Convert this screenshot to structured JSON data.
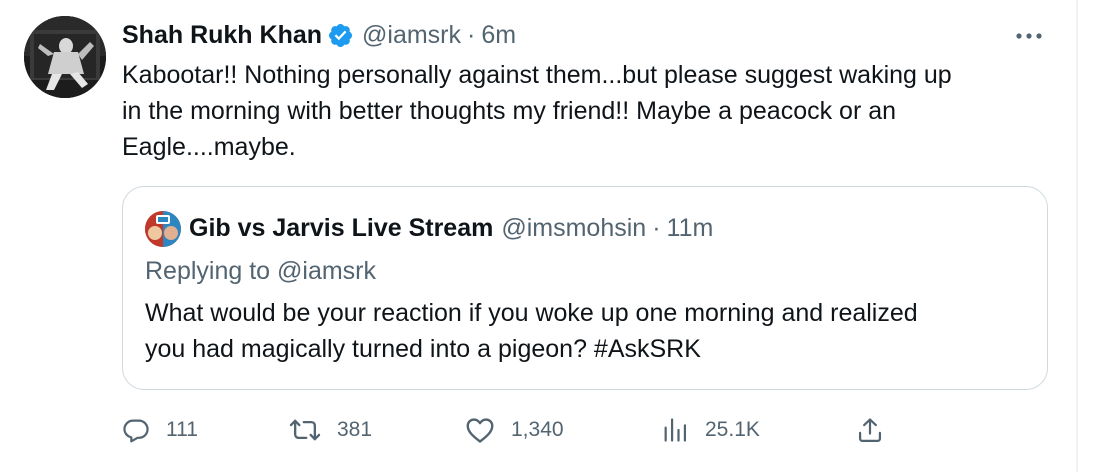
{
  "tweet": {
    "display_name": "Shah Rukh Khan",
    "handle": "@iamsrk",
    "separator": "·",
    "time": "6m",
    "text_lines": [
      "Kabootar!! Nothing personally against them...but please suggest waking up",
      "in the morning with better thoughts my friend!! Maybe a peacock or an",
      "Eagle....maybe."
    ],
    "verified_color": "#1d9bf0"
  },
  "quote": {
    "display_name": "Gib vs Jarvis Live Stream",
    "handle": "@imsmohsin",
    "separator": "·",
    "time": "11m",
    "replying_to": "Replying to @iamsrk",
    "text_lines": [
      "What would be your reaction if you woke up one morning and realized",
      "you had magically turned into a pigeon? #AskSRK"
    ]
  },
  "actions": {
    "replies": "111",
    "reposts": "381",
    "likes": "1,340",
    "views": "25.1K"
  },
  "icons": {
    "more": "more-options-icon",
    "reply": "reply-icon",
    "repost": "repost-icon",
    "like": "heart-icon",
    "views": "views-icon",
    "share": "share-icon",
    "verified": "verified-badge-icon"
  }
}
